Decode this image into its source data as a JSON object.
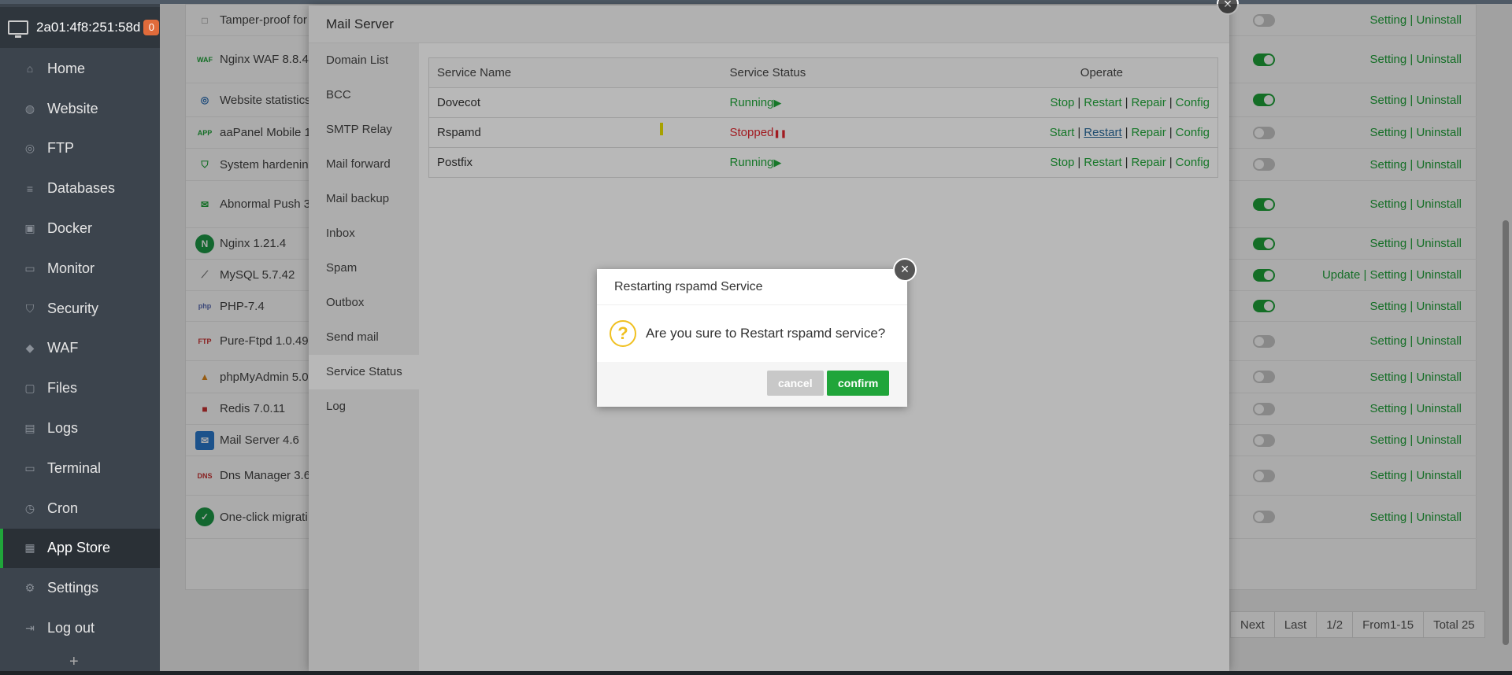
{
  "host": {
    "address": "2a01:4f8:251:58d",
    "badge": "0"
  },
  "nav": [
    {
      "label": "Home",
      "icon": "home-icon"
    },
    {
      "label": "Website",
      "icon": "globe-icon"
    },
    {
      "label": "FTP",
      "icon": "ftp-icon"
    },
    {
      "label": "Databases",
      "icon": "database-icon"
    },
    {
      "label": "Docker",
      "icon": "docker-icon"
    },
    {
      "label": "Monitor",
      "icon": "monitor-icon"
    },
    {
      "label": "Security",
      "icon": "shield-icon"
    },
    {
      "label": "WAF",
      "icon": "waf-icon"
    },
    {
      "label": "Files",
      "icon": "folder-icon"
    },
    {
      "label": "Logs",
      "icon": "logs-icon"
    },
    {
      "label": "Terminal",
      "icon": "terminal-icon"
    },
    {
      "label": "Cron",
      "icon": "clock-icon"
    },
    {
      "label": "App Store",
      "icon": "grid-icon",
      "active": true
    },
    {
      "label": "Settings",
      "icon": "gear-icon"
    },
    {
      "label": "Log out",
      "icon": "logout-icon"
    }
  ],
  "plugins": [
    {
      "name": "Tamper-proof for",
      "ops": "Setting | Uninstall",
      "on": false
    },
    {
      "name": "Nginx WAF 8.8.4",
      "ops": "Setting | Uninstall",
      "on": true
    },
    {
      "name": "Website statistics",
      "ops": "Setting | Uninstall",
      "on": true
    },
    {
      "name": "aaPanel Mobile 1",
      "ops": "Setting | Uninstall",
      "on": false
    },
    {
      "name": "System hardening",
      "ops": "Setting | Uninstall",
      "on": false
    },
    {
      "name": "Abnormal Push 3",
      "ops": "Setting | Uninstall",
      "on": true
    },
    {
      "name": "Nginx 1.21.4",
      "ops": "Setting | Uninstall",
      "on": true
    },
    {
      "name": "MySQL 5.7.42",
      "ops": "Update | Setting | Uninstall",
      "on": true
    },
    {
      "name": "PHP-7.4",
      "ops": "Setting | Uninstall",
      "on": true
    },
    {
      "name": "Pure-Ftpd 1.0.49",
      "ops": "Setting | Uninstall",
      "on": false
    },
    {
      "name": "phpMyAdmin 5.0",
      "ops": "Setting | Uninstall",
      "on": false
    },
    {
      "name": "Redis 7.0.11",
      "ops": "Setting | Uninstall",
      "on": false
    },
    {
      "name": "Mail Server 4.6",
      "ops": "Setting | Uninstall",
      "on": false
    },
    {
      "name": "Dns Manager 3.6",
      "ops": "Setting | Uninstall",
      "on": false
    },
    {
      "name": "One-click migrati",
      "ops": "Setting | Uninstall",
      "on": false
    }
  ],
  "pager": {
    "next": "Next",
    "last": "Last",
    "page": "1/2",
    "range": "From1-15",
    "total": "Total 25"
  },
  "mail": {
    "title": "Mail Server",
    "menu": [
      "Domain List",
      "BCC",
      "SMTP Relay",
      "Mail forward",
      "Mail backup",
      "Inbox",
      "Spam",
      "Outbox",
      "Send mail",
      "Service Status",
      "Log"
    ],
    "active_menu": "Service Status",
    "table": {
      "headers": [
        "Service Name",
        "Service Status",
        "Operate"
      ],
      "rows": [
        {
          "name": "Dovecot",
          "status": "Running",
          "state": "running",
          "ops": [
            "Stop",
            "Restart",
            "Repair",
            "Config"
          ]
        },
        {
          "name": "Rspamd",
          "status": "Stopped",
          "state": "stopped",
          "ops": [
            "Start",
            "Restart",
            "Repair",
            "Config"
          ]
        },
        {
          "name": "Postfix",
          "status": "Running",
          "state": "running",
          "ops": [
            "Stop",
            "Restart",
            "Repair",
            "Config"
          ]
        }
      ]
    }
  },
  "dialog": {
    "title": "Restarting rspamd Service",
    "message": "Are you sure to Restart rspamd service?",
    "cancel": "cancel",
    "confirm": "confirm"
  },
  "colors": {
    "green": "#20a53a",
    "red": "#e0262e",
    "sidebar": "#3c444d"
  }
}
